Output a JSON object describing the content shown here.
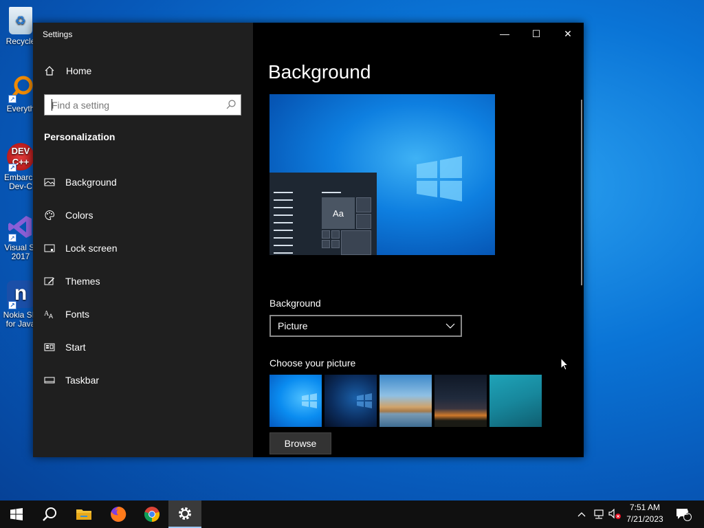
{
  "desktop": {
    "icons": [
      {
        "label": "Recycle"
      },
      {
        "label": "Everyth"
      },
      {
        "label": "Embarca",
        "label2": "Dev-C"
      },
      {
        "label": "Visual St",
        "label2": "2017"
      },
      {
        "label": "Nokia SD",
        "label2": "for Java"
      }
    ]
  },
  "window": {
    "title": "Settings",
    "controls": {
      "minimize": "—",
      "maximize": "☐",
      "close": "✕"
    }
  },
  "sidebar": {
    "home_label": "Home",
    "search_placeholder": "Find a setting",
    "section_title": "Personalization",
    "items": [
      {
        "label": "Background",
        "icon": "picture-icon"
      },
      {
        "label": "Colors",
        "icon": "palette-icon"
      },
      {
        "label": "Lock screen",
        "icon": "lock-screen-icon"
      },
      {
        "label": "Themes",
        "icon": "themes-icon"
      },
      {
        "label": "Fonts",
        "icon": "fonts-icon"
      },
      {
        "label": "Start",
        "icon": "start-icon"
      },
      {
        "label": "Taskbar",
        "icon": "taskbar-icon"
      }
    ]
  },
  "content": {
    "page_title": "Background",
    "preview_tile_text": "Aa",
    "background_label": "Background",
    "background_value": "Picture",
    "choose_label": "Choose your picture",
    "browse_label": "Browse"
  },
  "taskbar": {
    "time": "7:51 AM",
    "date": "7/21/2023",
    "notification_count": "2"
  },
  "colors": {
    "sidebar_bg": "#1f1f1f",
    "content_bg": "#000000",
    "taskbar_bg": "#101010",
    "accent": "#0a74d6"
  }
}
